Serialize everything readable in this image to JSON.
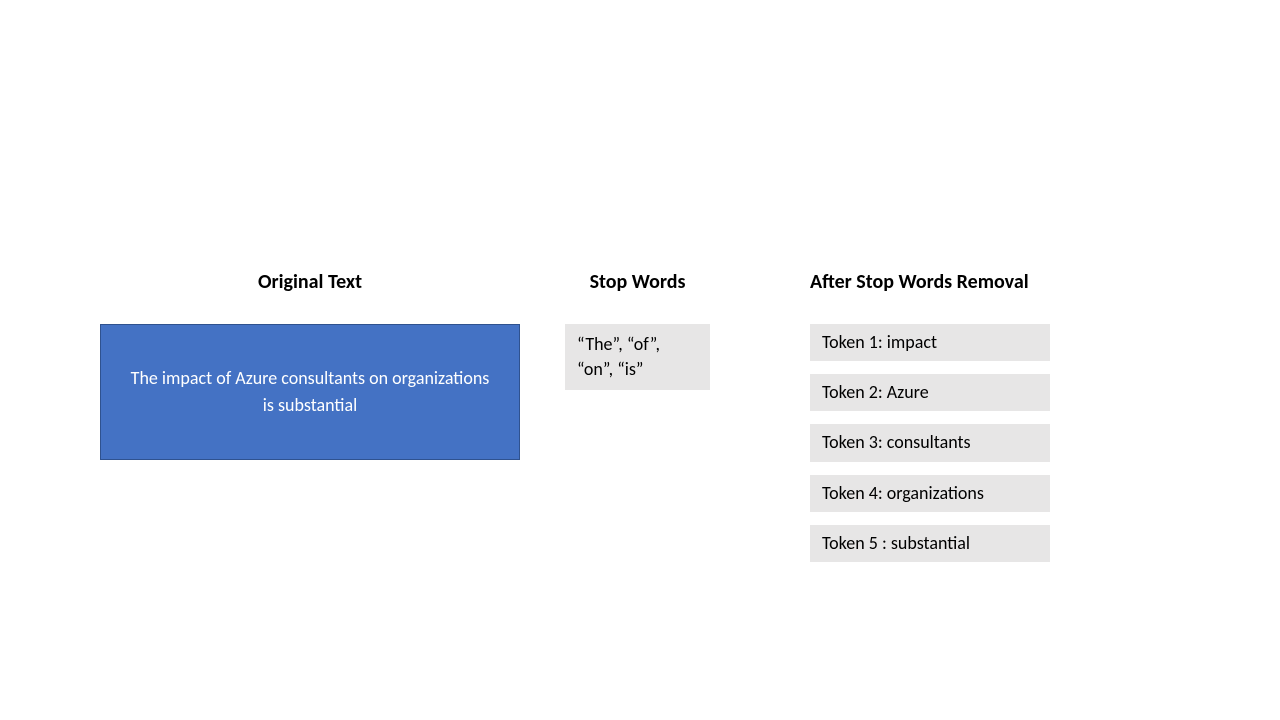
{
  "headings": {
    "original": "Original Text",
    "stopwords": "Stop Words",
    "after": "After Stop Words Removal"
  },
  "originalText": "The impact of Azure consultants on organizations is substantial",
  "stopWordsText": "“The”, “of”, “on”, “is”",
  "tokens": {
    "t1": "Token 1: impact",
    "t2": "Token 2: Azure",
    "t3": "Token 3: consultants",
    "t4": "Token 4: organizations",
    "t5": "Token 5 : substantial"
  }
}
